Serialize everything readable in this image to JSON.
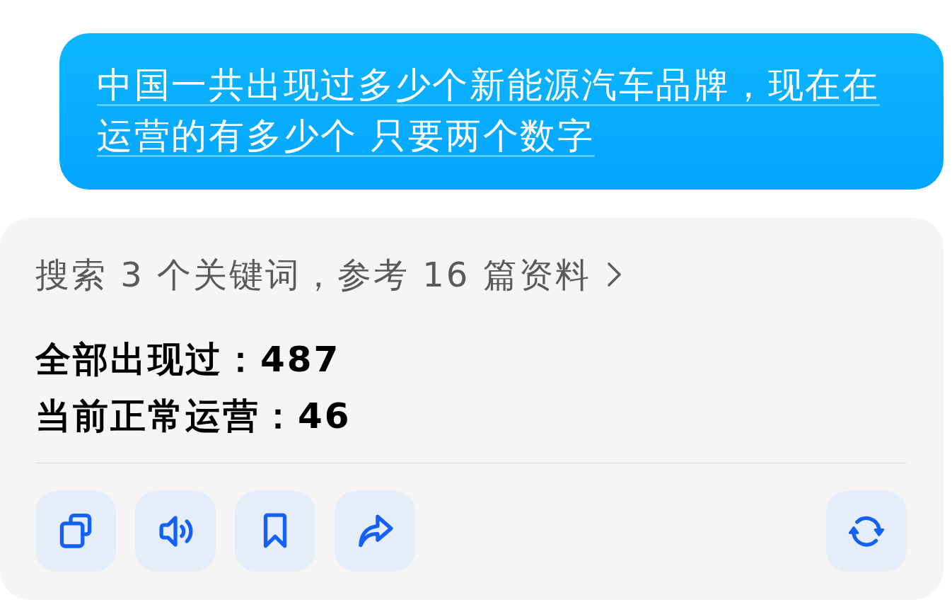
{
  "user_message": {
    "text": "中国一共出现过多少个新能源汽车品牌，现在在运营的有多少个 只要两个数字"
  },
  "answer": {
    "sources_summary": "搜索 3 个关键词，参考 16 篇资料",
    "lines": [
      "全部出现过：487",
      "当前正常运营：46"
    ]
  },
  "actions": [
    {
      "kind": "copy"
    },
    {
      "kind": "speak"
    },
    {
      "kind": "bookmark"
    },
    {
      "kind": "share"
    }
  ],
  "end_actions": [
    {
      "kind": "regenerate"
    }
  ]
}
